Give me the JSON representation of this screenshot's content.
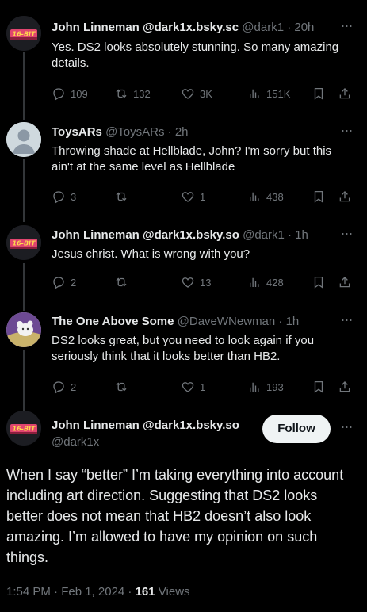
{
  "tweets": [
    {
      "name": "John Linneman @dark1x.bsky.sc",
      "handle": "@dark1 · 20h",
      "text": "Yes. DS2 looks absolutely stunning. So many amazing details.",
      "replies": "109",
      "retweets": "132",
      "likes": "3K",
      "views": "151K",
      "avatar": "16-bit-logo"
    },
    {
      "name": "ToysARs",
      "handle": "@ToysARs · 2h",
      "text": "Throwing shade at Hellblade, John? I'm sorry but this ain't at the same level as Hellblade",
      "replies": "3",
      "retweets": "",
      "likes": "1",
      "views": "438",
      "avatar": "default-avatar"
    },
    {
      "name": "John Linneman @dark1x.bsky.so",
      "handle": "@dark1 · 1h",
      "text": "Jesus christ. What is wrong with you?",
      "replies": "2",
      "retweets": "",
      "likes": "13",
      "views": "428",
      "avatar": "16-bit-logo"
    },
    {
      "name": "The One Above Some",
      "handle": "@DaveWNewman · 1h",
      "text": "DS2 looks great, but you need to look again if you seriously think that it looks better than HB2.",
      "replies": "2",
      "retweets": "",
      "likes": "1",
      "views": "193",
      "avatar": "custom-avatar"
    }
  ],
  "main": {
    "name": "John Linneman @dark1x.bsky.so",
    "handle": "@dark1x",
    "follow_label": "Follow",
    "text": "When I say “better” I’m taking everything into account including art direction. Suggesting that DS2 looks better does not mean that HB2 doesn’t also look amazing. I’m allowed to have my opinion on such things.",
    "time": "1:54 PM · Feb 1, 2024 · ",
    "views_count": "161",
    "views_label": " Views"
  },
  "icons": [
    "reply-icon",
    "retweet-icon",
    "like-icon",
    "views-icon",
    "bookmark-icon",
    "share-icon",
    "more-icon"
  ],
  "colors": {
    "background": "#000000",
    "text": "#e7e9ea",
    "muted": "#71767b",
    "follow_bg": "#eff3f4"
  },
  "avatar_badge_text": "16-BIT"
}
